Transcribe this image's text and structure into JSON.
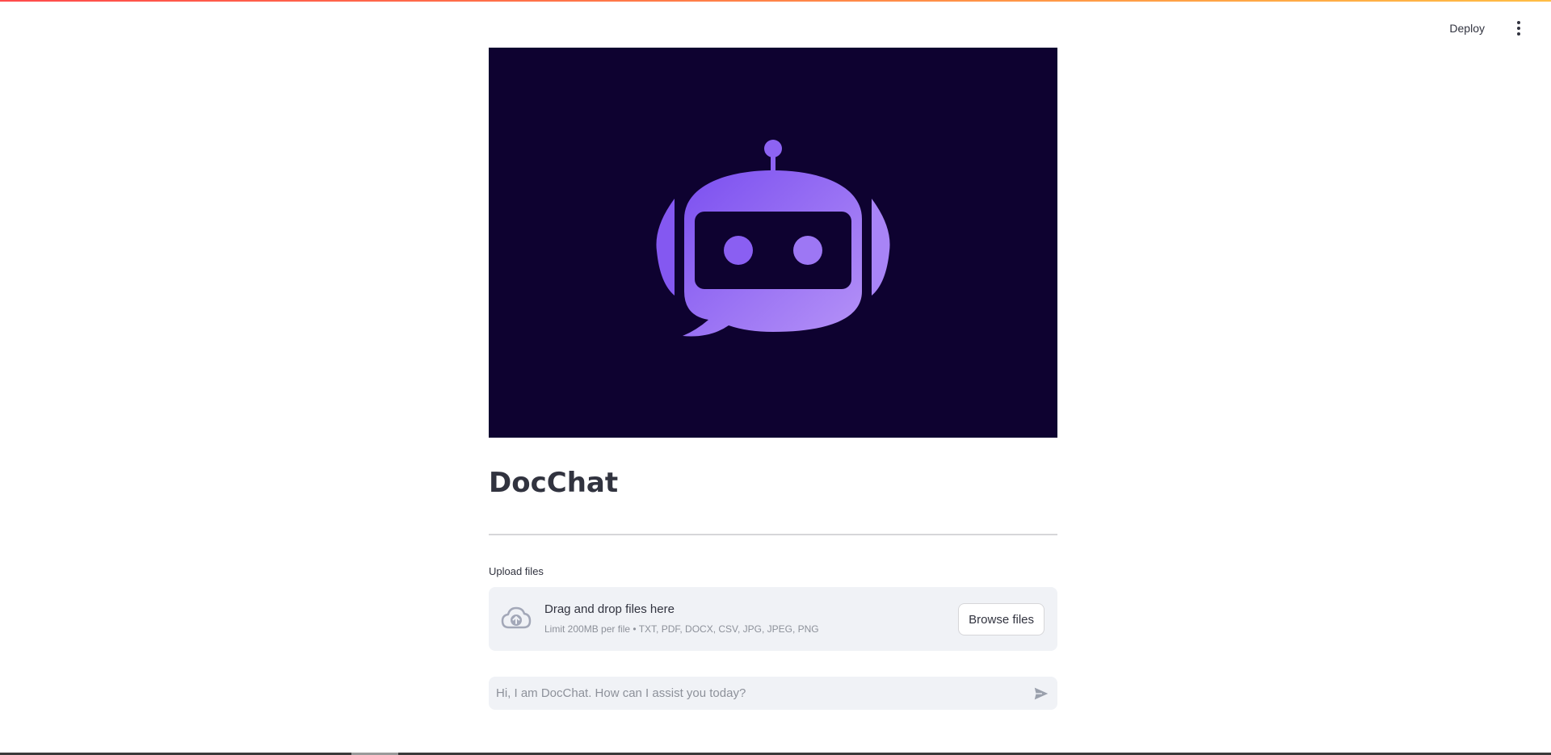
{
  "header": {
    "deploy_label": "Deploy",
    "menu_icon": "more-vertical-icon"
  },
  "hero": {
    "icon": "robot-chat-icon",
    "background": "#0e0230",
    "accent": "#8b5cf6"
  },
  "main": {
    "title": "DocChat"
  },
  "uploader": {
    "label": "Upload files",
    "icon": "cloud-upload-icon",
    "dropzone_title": "Drag and drop files here",
    "dropzone_subtitle": "Limit 200MB per file • TXT, PDF, DOCX, CSV, JPG, JPEG, PNG",
    "browse_label": "Browse files"
  },
  "chat": {
    "placeholder": "Hi, I am DocChat. How can I assist you today?",
    "value": "",
    "send_icon": "send-icon"
  },
  "colors": {
    "text": "#31333f",
    "muted": "#8d919a",
    "panel": "#f0f2f6"
  }
}
